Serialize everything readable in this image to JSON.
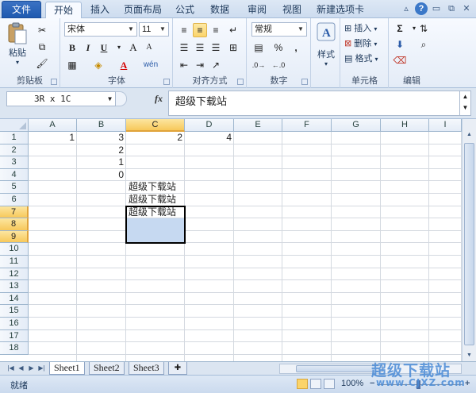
{
  "ribbon_tabs": [
    "文件",
    "开始",
    "插入",
    "页面布局",
    "公式",
    "数据",
    "审阅",
    "视图",
    "新建选项卡"
  ],
  "window_controls": [
    "chevron-up-icon",
    "help-icon",
    "minimize-icon",
    "restore-icon",
    "close-icon"
  ],
  "clipboard": {
    "paste": "粘贴",
    "label": "剪贴板"
  },
  "font": {
    "family": "宋体",
    "size": "11",
    "label": "字体",
    "bold": "B",
    "italic": "I",
    "underline": "U",
    "grow": "A",
    "shrink": "A",
    "color_letter": "A",
    "phonetic": "wén"
  },
  "alignment": {
    "label": "对齐方式"
  },
  "number": {
    "format": "常规",
    "percent": "%",
    "comma": ",",
    "label": "数字"
  },
  "styles": {
    "label": "样式"
  },
  "cells_group": {
    "insert": "插入",
    "delete": "删除",
    "format": "格式",
    "label": "单元格"
  },
  "editing": {
    "sum": "Σ",
    "label": "编辑"
  },
  "formula_bar": {
    "name_box": "3R x 1C",
    "fx": "fx",
    "content": "超级下载站"
  },
  "columns": [
    "A",
    "B",
    "C",
    "D",
    "E",
    "F",
    "G",
    "H",
    "I"
  ],
  "rows": [
    "1",
    "2",
    "3",
    "4",
    "5",
    "6",
    "7",
    "8",
    "9",
    "10",
    "11",
    "12",
    "13",
    "14",
    "15",
    "16",
    "17",
    "18"
  ],
  "cells": {
    "A1": "1",
    "B1": "3",
    "B2": "2",
    "B3": "1",
    "B4": "0",
    "C1": "2",
    "C5": "超级下载站",
    "C6": "超级下载站",
    "C7": "超级下载站",
    "D1": "4"
  },
  "sheets": [
    "Sheet1",
    "Sheet2",
    "Sheet3"
  ],
  "status": {
    "text": "就绪",
    "zoom": "100%",
    "zoom_minus": "−",
    "zoom_plus": "+"
  },
  "watermark": {
    "main": "超级下载站",
    "sub": "www.CJXZ.com"
  },
  "colors": {
    "accent": "#1f5ab0",
    "selection_fill": "#c6d9f1",
    "header_selected": "#f7c85b",
    "watermark": "#4a8bd6"
  }
}
